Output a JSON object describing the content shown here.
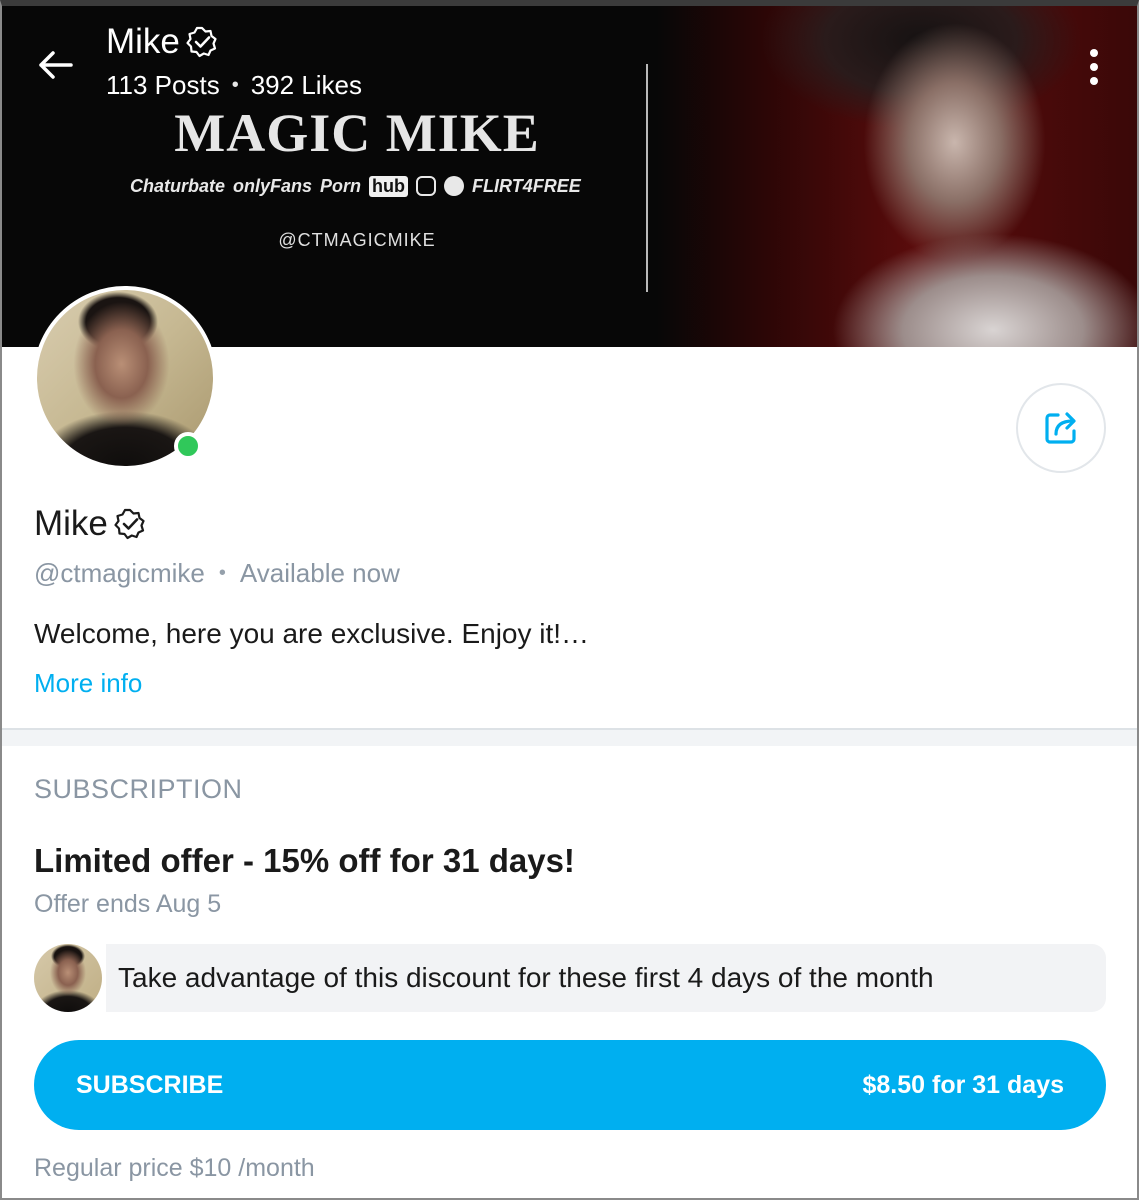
{
  "header": {
    "name": "Mike",
    "posts": "113 Posts",
    "likes": "392 Likes",
    "separator": "•"
  },
  "cover": {
    "title": "MAGIC MIKE",
    "handle": "@CTMAGICMIKE",
    "brands": [
      "Chaturbate",
      "onlyFans",
      "Porn",
      "hub",
      "FLIRT4FREE"
    ]
  },
  "profile": {
    "name": "Mike",
    "username": "@ctmagicmike",
    "separator": "•",
    "status": "Available now",
    "bio": "Welcome, here you are exclusive. Enjoy it!…",
    "more_info": "More info"
  },
  "subscription": {
    "heading": "SUBSCRIPTION",
    "offer_title": "Limited offer - 15% off for 31 days!",
    "offer_ends": "Offer ends Aug 5",
    "message": "Take advantage of this discount for these first 4 days of the month",
    "button_label": "SUBSCRIBE",
    "button_price": "$8.50 for 31 days",
    "regular_price": "Regular price $10 /month"
  },
  "colors": {
    "accent": "#00aff0",
    "online": "#30c85a",
    "muted_text": "#8a96a3"
  },
  "icons": [
    "back-arrow-icon",
    "verified-badge-icon",
    "more-vertical-icon",
    "share-icon"
  ]
}
